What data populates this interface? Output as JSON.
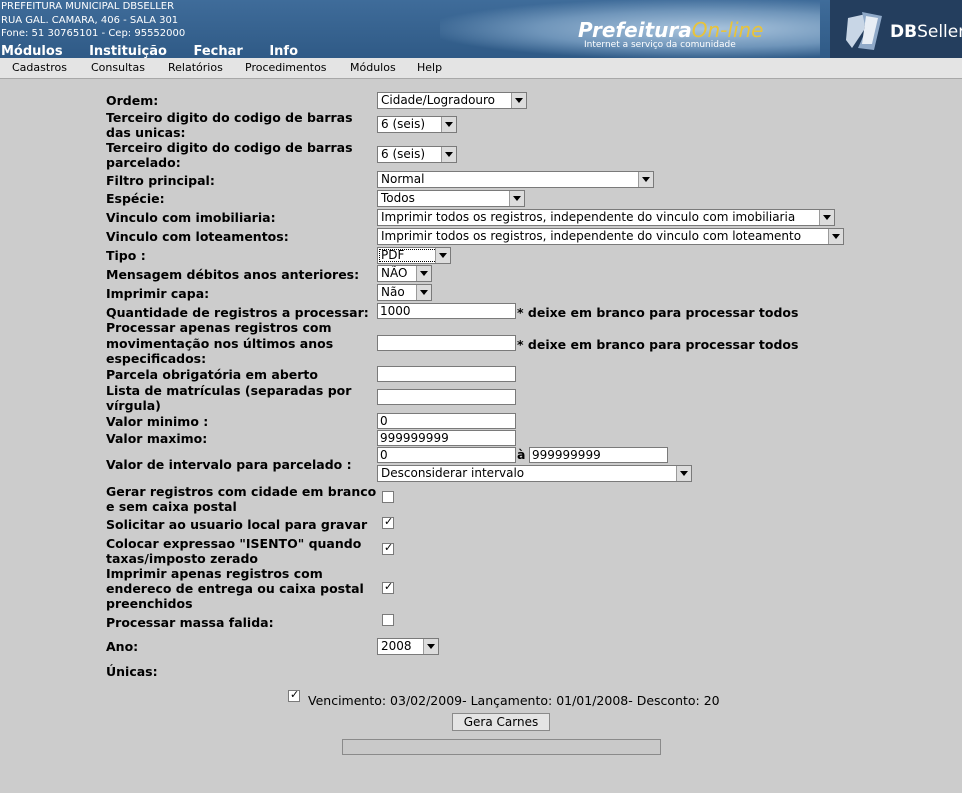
{
  "header": {
    "org_line1": "PREFEITURA MUNICIPAL DBSELLER",
    "org_line2": "RUA GAL. CAMARA, 406 - SALA 301",
    "org_line3": "Fone: 51 30765101  -  Cep: 95552000",
    "nav": [
      "Módulos",
      "Instituição",
      "Fechar",
      "Info"
    ],
    "brand_prefeitura": "Prefeitura",
    "brand_online": "On-line",
    "brand_tagline": "Internet a serviço da comunidade",
    "dbseller_db": "DB",
    "dbseller_seller": "Seller"
  },
  "menubar": [
    "Cadastros",
    "Consultas",
    "Relatórios",
    "Procedimentos",
    "Módulos",
    "Help"
  ],
  "form": {
    "ordem": {
      "label": "Ordem:",
      "value": "Cidade/Logradouro"
    },
    "terc_unicas": {
      "label1": "Terceiro digito do codigo de barras",
      "label2": "das unicas:",
      "value": "6 (seis)"
    },
    "terc_parcelado": {
      "label1": "Terceiro digito do codigo de barras",
      "label2": "parcelado:",
      "value": "6 (seis)"
    },
    "filtro": {
      "label": "Filtro principal:",
      "value": "Normal"
    },
    "especie": {
      "label": "Espécie:",
      "value": "Todos"
    },
    "imobiliaria": {
      "label": "Vinculo com imobiliaria:",
      "value": "Imprimir todos os registros, independente do vinculo com imobiliaria"
    },
    "loteamentos": {
      "label": "Vinculo com loteamentos:",
      "value": "Imprimir todos os registros, independente do vinculo com loteamento"
    },
    "tipo": {
      "label": "Tipo :",
      "value": "PDF"
    },
    "mensagem": {
      "label": "Mensagem débitos anos anteriores:",
      "value": "NÃO"
    },
    "capa": {
      "label": "Imprimir capa:",
      "value": "Não"
    },
    "quantidade": {
      "label": "Quantidade de registros a processar:",
      "value": "1000",
      "hint": "* deixe em branco para processar todos"
    },
    "movimentacao": {
      "label1": "Processar apenas registros com",
      "label2": "movimentação nos últimos anos",
      "label3": "especificados:",
      "value": "",
      "hint": "* deixe em branco para processar todos"
    },
    "parcela": {
      "label": "Parcela obrigatória em aberto",
      "value": ""
    },
    "matriculas": {
      "label1": "Lista de matrículas (separadas por",
      "label2": "vírgula)",
      "value": ""
    },
    "valor_min": {
      "label": "Valor minimo :",
      "value": "0"
    },
    "valor_max": {
      "label": "Valor maximo:",
      "value": "999999999"
    },
    "intervalo": {
      "label": "Valor de intervalo para parcelado :",
      "from": "0",
      "sep": "à",
      "to": "999999999",
      "option": "Desconsiderar intervalo"
    },
    "cidade_branco": {
      "label1": "Gerar registros com cidade em branco",
      "label2": "e sem caixa postal",
      "checked": false
    },
    "solicitar": {
      "label": "Solicitar ao usuario local para gravar",
      "checked": true
    },
    "isento": {
      "label1": "Colocar expressao \"ISENTO\" quando",
      "label2": "taxas/imposto zerado",
      "checked": true
    },
    "endereco": {
      "label1": "Imprimir apenas registros com",
      "label2": "endereco de entrega ou caixa postal",
      "label3": "preenchidos",
      "checked": true
    },
    "massa_falida": {
      "label": "Processar massa falida:",
      "checked": false
    },
    "ano": {
      "label": "Ano:",
      "value": "2008"
    },
    "unicas": {
      "label": "Únicas:"
    },
    "vencimento": {
      "text": "Vencimento: 03/02/2009- Lançamento: 01/01/2008- Desconto: 20",
      "checked": true
    },
    "submit": "Gera Carnes"
  }
}
